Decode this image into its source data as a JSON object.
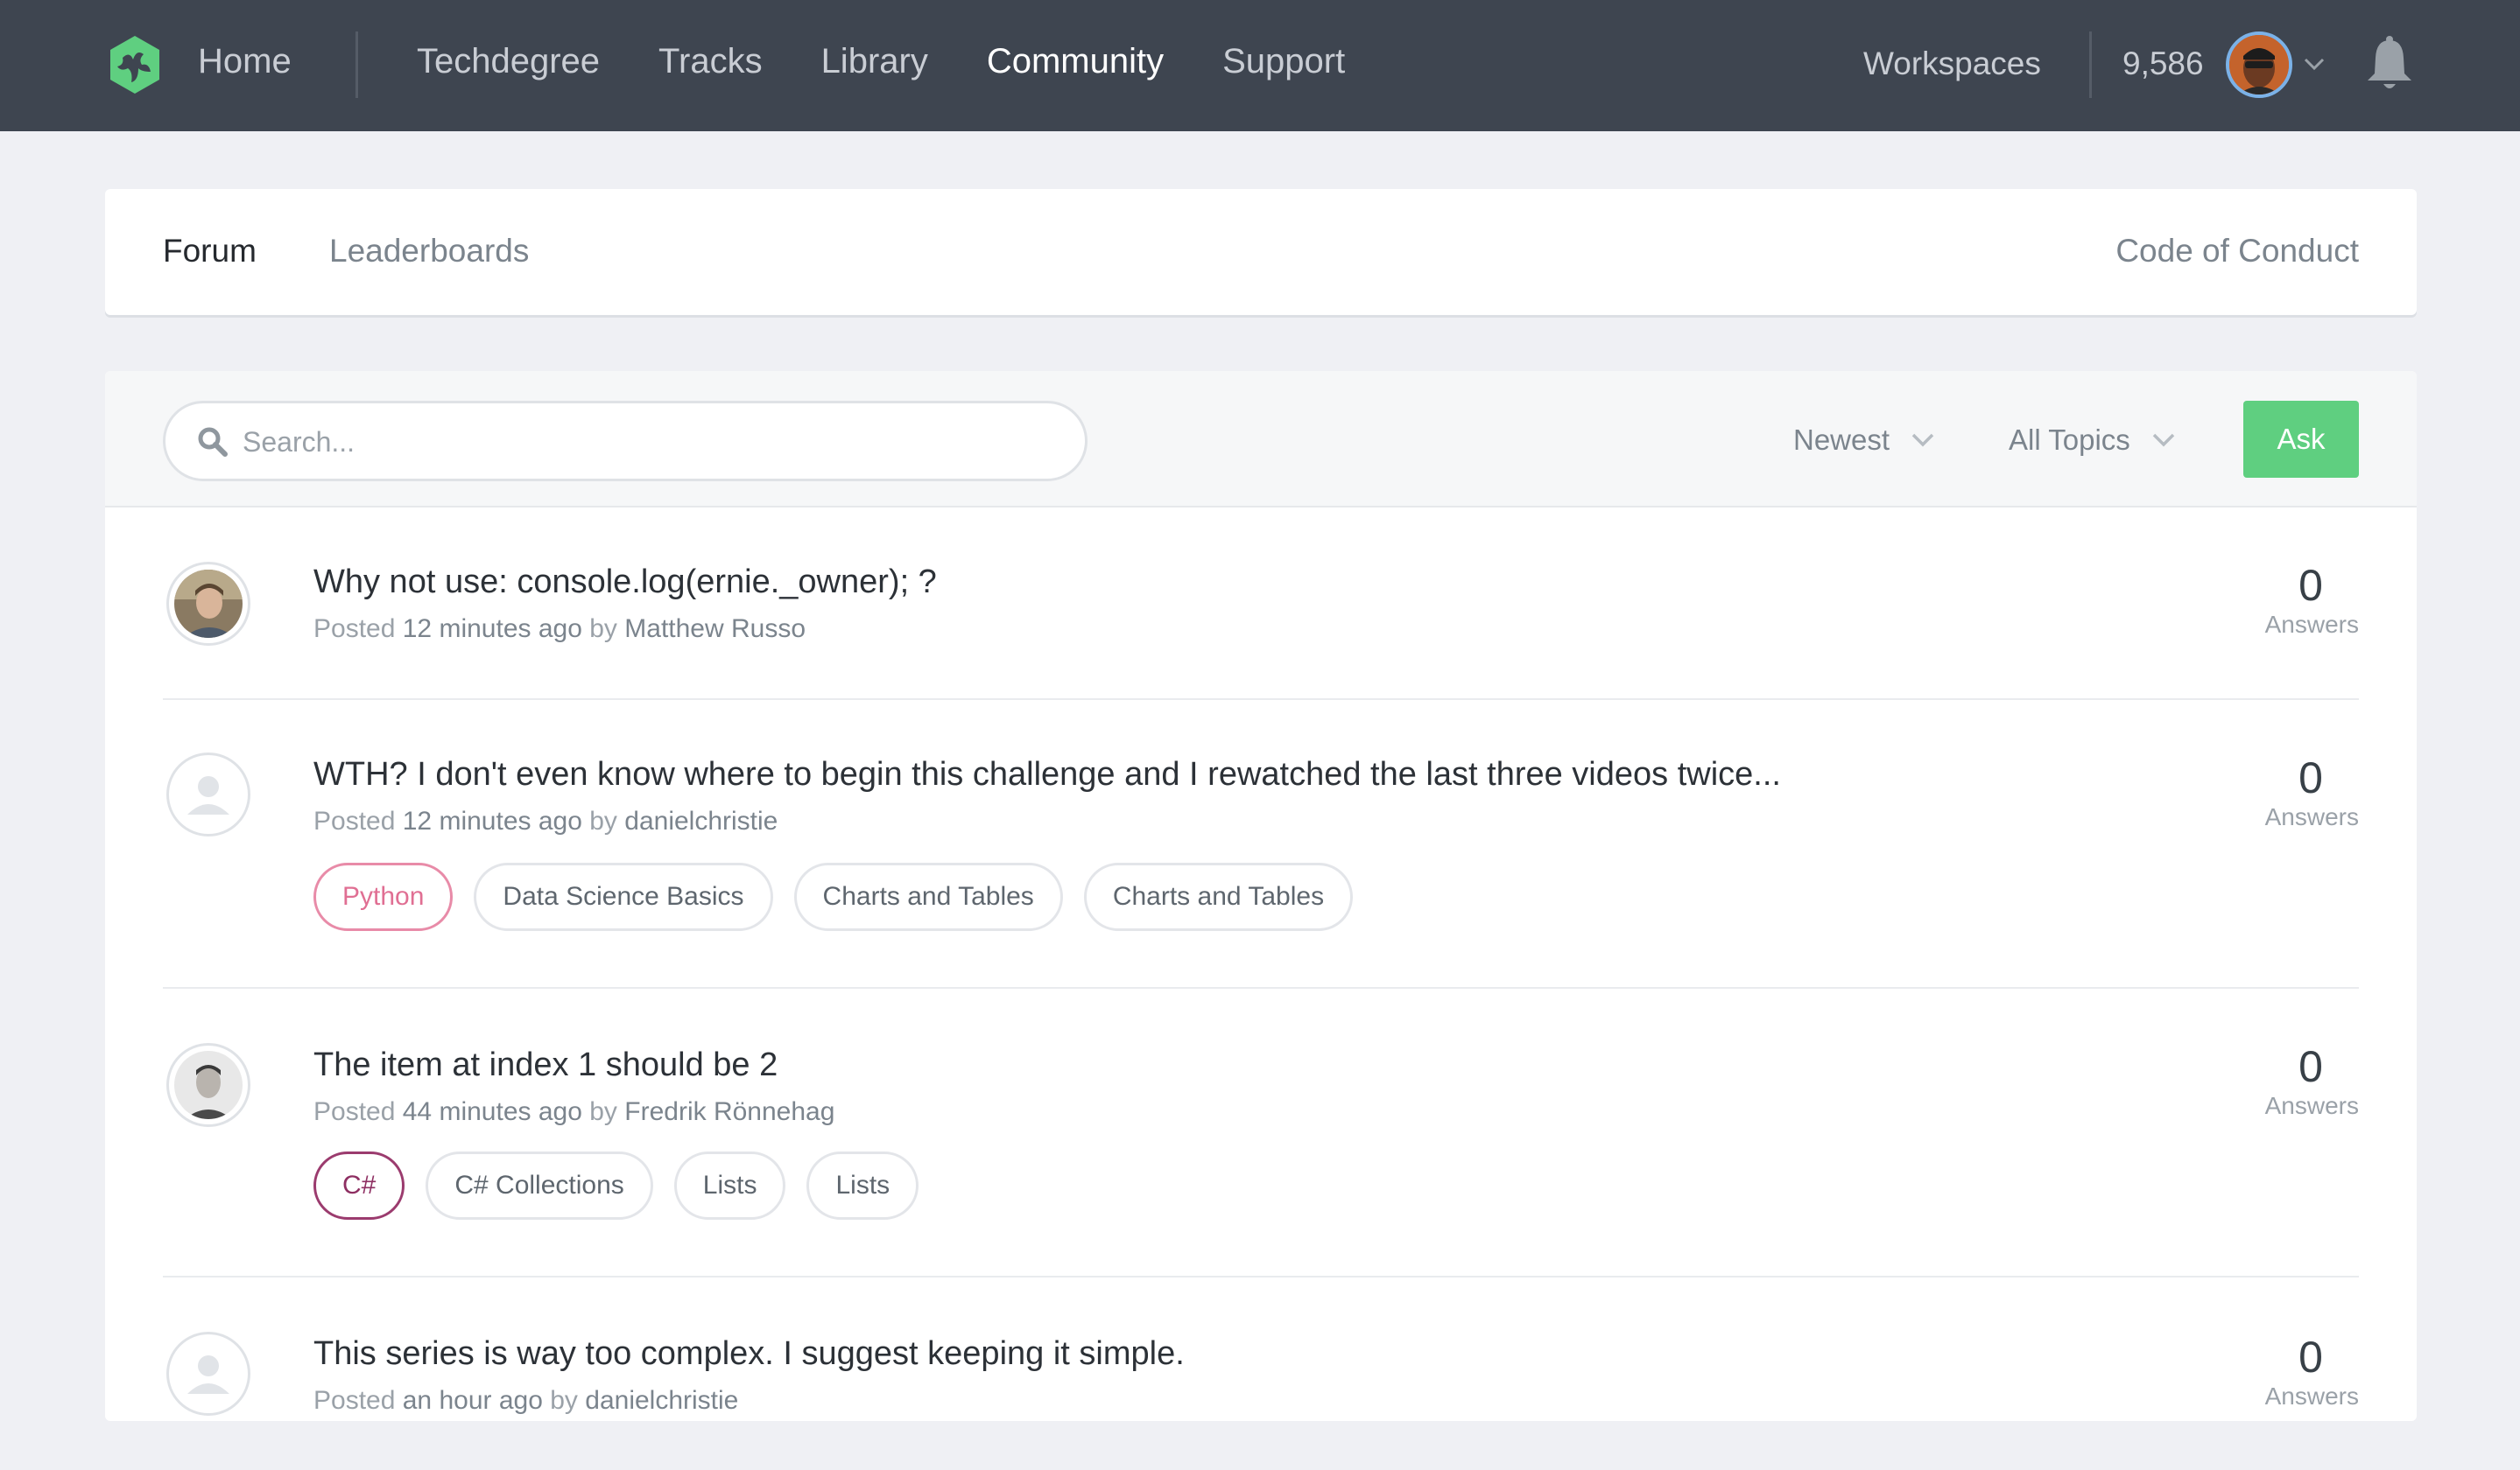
{
  "topnav": {
    "home": "Home",
    "links": [
      "Techdegree",
      "Tracks",
      "Library",
      "Community",
      "Support"
    ],
    "active": "Community",
    "workspaces": "Workspaces",
    "points": "9,586"
  },
  "subnav": {
    "forum": "Forum",
    "leaderboards": "Leaderboards",
    "code_of_conduct": "Code of Conduct"
  },
  "toolbar": {
    "search_placeholder": "Search...",
    "sort": "Newest",
    "topics": "All Topics",
    "ask": "Ask"
  },
  "posts": [
    {
      "title": "Why not use: console.log(ernie._owner); ?",
      "posted_label": "Posted",
      "time": "12 minutes ago",
      "by_label": "by",
      "author": "Matthew Russo",
      "answers": "0",
      "answers_label": "Answers",
      "tags": []
    },
    {
      "title": "WTH? I don't even know where to begin this challenge and I rewatched the last three videos twice...",
      "posted_label": "Posted",
      "time": "12 minutes ago",
      "by_label": "by",
      "author": "danielchristie",
      "answers": "0",
      "answers_label": "Answers",
      "tags": [
        "Python",
        "Data Science Basics",
        "Charts and Tables",
        "Charts and Tables"
      ]
    },
    {
      "title": "The item at index 1 should be 2",
      "posted_label": "Posted",
      "time": "44 minutes ago",
      "by_label": "by",
      "author": "Fredrik Rönnehag",
      "answers": "0",
      "answers_label": "Answers",
      "tags": [
        "C#",
        "C# Collections",
        "Lists",
        "Lists"
      ]
    },
    {
      "title": "This series is way too complex. I suggest keeping it simple.",
      "posted_label": "Posted",
      "time": "an hour ago",
      "by_label": "by",
      "author": "danielchristie",
      "answers": "0",
      "answers_label": "Answers",
      "tags": []
    }
  ],
  "colors": {
    "nav_bg": "#3e4550",
    "ask_green": "#5fcf80",
    "python_tag": "#e06f93",
    "csharp_tag": "#8e2f62",
    "logo_green": "#5fcf80"
  },
  "icons": [
    "treehouse-logo-icon",
    "chevron-down-icon",
    "bell-icon",
    "search-icon",
    "default-avatar-icon"
  ]
}
